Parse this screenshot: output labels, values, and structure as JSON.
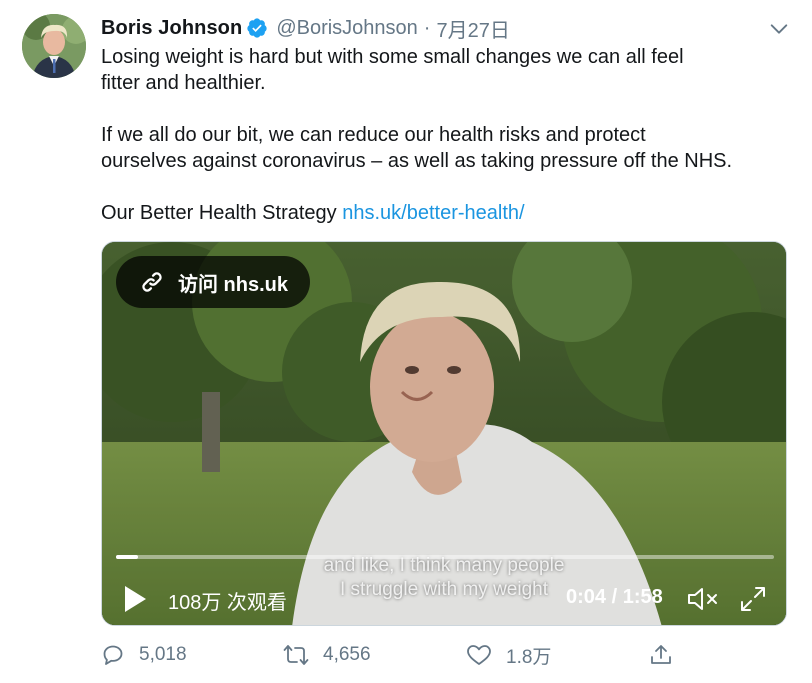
{
  "author": {
    "name": "Boris Johnson",
    "handle": "@BorisJohnson",
    "separator": "·",
    "date": "7月27日",
    "verified": true
  },
  "tweet": {
    "line1": "Losing weight is hard but with some small changes we can all feel",
    "line2": "fitter and healthier.",
    "line3": "If we all do our bit, we can reduce our health risks and protect",
    "line4": "ourselves against coronavirus – as well as taking pressure off the NHS.",
    "line5_prefix": "Our Better Health Strategy ",
    "link_text": "nhs.uk/better-health/"
  },
  "video": {
    "visit_label": "访问 nhs.uk",
    "subtitle_1": "and like, I think many people",
    "subtitle_2": "I struggle with my weight",
    "views": "108万 次观看",
    "time": "0:04 / 1:58",
    "progress_fraction": 0.034
  },
  "actions": {
    "replies": "5,018",
    "retweets": "4,656",
    "likes": "1.8万"
  },
  "colors": {
    "link": "#1b95e0",
    "secondary_text": "#657786",
    "verified": "#1da1f2"
  },
  "icons": [
    "verified-badge-icon",
    "caret-down-icon",
    "link-icon",
    "play-icon",
    "mute-icon",
    "fullscreen-icon",
    "reply-icon",
    "retweet-icon",
    "like-icon",
    "share-icon"
  ]
}
